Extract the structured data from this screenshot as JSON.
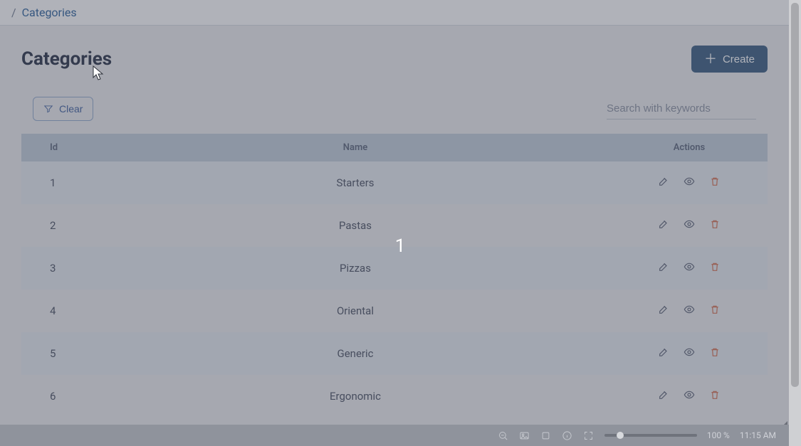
{
  "breadcrumb": {
    "slash": "/",
    "current": "Categories"
  },
  "header": {
    "title": "Categories",
    "create_label": "Create"
  },
  "toolbar": {
    "clear_label": "Clear"
  },
  "search": {
    "placeholder": "Search with keywords"
  },
  "table": {
    "columns": {
      "id": "Id",
      "name": "Name",
      "actions": "Actions"
    },
    "rows": [
      {
        "id": "1",
        "name": "Starters"
      },
      {
        "id": "2",
        "name": "Pastas"
      },
      {
        "id": "3",
        "name": "Pizzas"
      },
      {
        "id": "4",
        "name": "Oriental"
      },
      {
        "id": "5",
        "name": "Generic"
      },
      {
        "id": "6",
        "name": "Ergonomic"
      }
    ]
  },
  "overlay": {
    "label": "1"
  },
  "statusbar": {
    "zoom": "100 %",
    "time": "11:15 AM"
  }
}
